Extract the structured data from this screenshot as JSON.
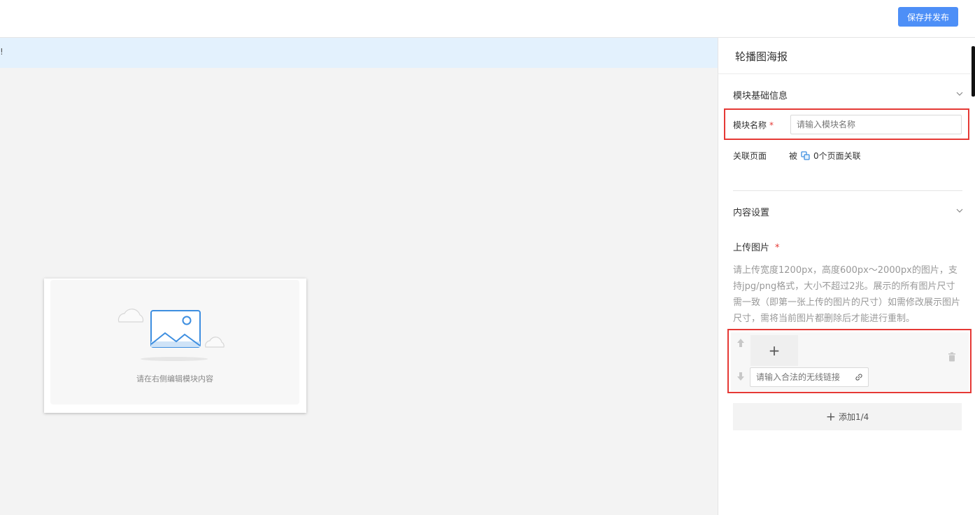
{
  "header": {
    "publish_label": "保存并发布"
  },
  "canvas": {
    "notice_text": "!",
    "preview_hint": "请在右侧编辑模块内容"
  },
  "panel": {
    "title": "轮播图海报",
    "basic_section": {
      "title": "模块基础信息",
      "name_label": "模块名称",
      "required_mark": "*",
      "name_placeholder": "请输入模块名称",
      "related_label": "关联页面",
      "related_prefix": "被",
      "related_count_text": "0个页面关联"
    },
    "content_section": {
      "title": "内容设置",
      "upload_label": "上传图片",
      "required_mark": "*",
      "upload_desc": "请上传宽度1200px，高度600px～2000px的图片，支持jpg/png格式，大小不超过2兆。展示的所有图片尺寸需一致（即第一张上传的图片的尺寸）如需修改展示图片尺寸，需将当前图片都删除后才能进行重制。",
      "upload_plus": "+",
      "link_placeholder": "请输入合法的无线链接",
      "add_label": "添加1/4"
    }
  },
  "colors": {
    "accent": "#4d8ff7",
    "notice_bg": "#e3f1fd",
    "highlight": "#e53935"
  }
}
